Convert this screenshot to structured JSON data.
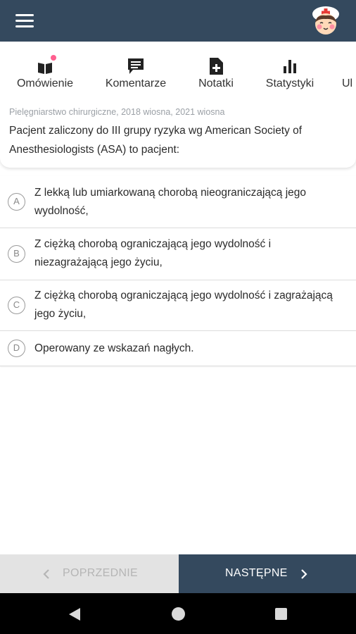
{
  "header": {
    "menu_icon": "hamburger-menu-icon",
    "avatar_icon": "nurse-avatar-icon",
    "colors": {
      "bar": "#34495e"
    }
  },
  "tabs": [
    {
      "label": "Omówienie",
      "icon": "book-icon",
      "has_notification": true
    },
    {
      "label": "Komentarze",
      "icon": "comment-icon"
    },
    {
      "label": "Notatki",
      "icon": "note-add-icon"
    },
    {
      "label": "Statystyki",
      "icon": "bar-chart-icon"
    },
    {
      "label": "Ul",
      "icon": ""
    }
  ],
  "question": {
    "meta": "Pielęgniarstwo chirurgiczne, 2018 wiosna, 2021 wiosna",
    "text": "Pacjent zaliczony do III grupy ryzyka wg American Society of Anesthesiologists (ASA) to pacjent:"
  },
  "answers": [
    {
      "letter": "A",
      "text": "Z lekką lub umiarkowaną chorobą nieograniczającą jego wydolność,"
    },
    {
      "letter": "B",
      "text": "Z ciężką chorobą ograniczającą jego wydolność i niezagrażającą jego życiu,"
    },
    {
      "letter": "C",
      "text": "Z ciężką chorobą ograniczającą jego wydolność i zagrażającą jego życiu,"
    },
    {
      "letter": "D",
      "text": "Operowany ze wskazań nagłych."
    }
  ],
  "navigation": {
    "prev_label": "POPRZEDNIE",
    "next_label": "NASTĘPNE"
  },
  "system_nav": {
    "back_icon": "back-triangle-icon",
    "home_icon": "home-circle-icon",
    "recents_icon": "recents-square-icon"
  }
}
